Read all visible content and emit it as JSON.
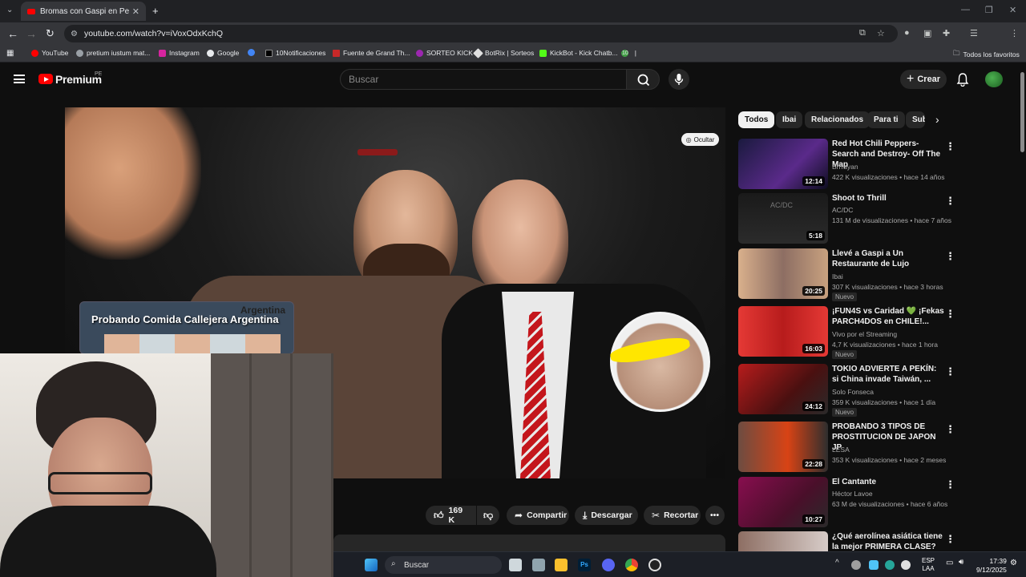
{
  "browser": {
    "tab_title": "Bromas con Gaspi en Perú - YouTube",
    "url": "youtube.com/watch?v=iVoxOdxKchQ",
    "bookmarks": [
      "YouTube",
      "pretium iustum mat...",
      "Instagram",
      "Google",
      "10Notificaciones",
      "Fuente de Grand Th...",
      "SORTEO KICK",
      "BotRix | Sorteos",
      "KickBot - Kick Chatb...",
      "10"
    ],
    "all_bookmarks": "Todos los favoritos"
  },
  "header": {
    "logo_text": "Premium",
    "region": "PE",
    "search_placeholder": "Buscar",
    "create_label": "Crear"
  },
  "player": {
    "hide_label": "Ocultar",
    "overlay_card_title": "Probando Comida Callejera Argentina",
    "overlay_card_tag": "Argentina"
  },
  "actions": {
    "likes": "169 K",
    "share": "Compartir",
    "download": "Descargar",
    "clip": "Recortar"
  },
  "chips": [
    "Todos",
    "Ibai",
    "Relacionados",
    "Para ti",
    "Sub"
  ],
  "recommendations": [
    {
      "title": "Red Hot Chili Peppers- Search and Destroy- Off The Map",
      "channel": "Brrrayan",
      "meta": "422 K visualizaciones • hace 14 años",
      "duration": "12:14",
      "badge": ""
    },
    {
      "title": "Shoot to Thrill",
      "channel": "AC/DC",
      "meta": "131 M de visualizaciones • hace 7 años",
      "duration": "5:18",
      "badge": ""
    },
    {
      "title": "Llevé a Gaspi a Un Restaurante de Lujo",
      "channel": "Ibai",
      "meta": "307 K visualizaciones • hace 3 horas",
      "duration": "20:25",
      "badge": "Nuevo"
    },
    {
      "title": "¡FUN4S vs Caridad 💚 ¡Fekas PARCH4DOS en CHILE!...",
      "channel": "Vivo por el Streaming",
      "meta": "4,7 K visualizaciones • hace 1 hora",
      "duration": "16:03",
      "badge": "Nuevo"
    },
    {
      "title": "TOKIO ADVIERTE A PEKÍN: si China invade Taiwán, ...",
      "channel": "Solo Fonseca",
      "meta": "359 K visualizaciones • hace 1 día",
      "duration": "24:12",
      "badge": "Nuevo"
    },
    {
      "title": "PROBANDO 3 TIPOS DE PROSTITUCION DE JAPON JP",
      "channel": "LESA",
      "meta": "353 K visualizaciones • hace 2 meses",
      "duration": "22:28",
      "badge": ""
    },
    {
      "title": "El Cantante",
      "channel": "Héctor Lavoe",
      "meta": "63 M de visualizaciones • hace 6 años",
      "duration": "10:27",
      "badge": ""
    },
    {
      "title": "¿Qué aerolínea asiática tiene la mejor PRIMERA CLASE? ✈️",
      "channel": "",
      "meta": "",
      "duration": "",
      "badge": ""
    }
  ],
  "taskbar": {
    "search": "Buscar",
    "lang": "ESP",
    "lang2": "LAA",
    "time": "17:39",
    "date": "9/12/2025"
  }
}
